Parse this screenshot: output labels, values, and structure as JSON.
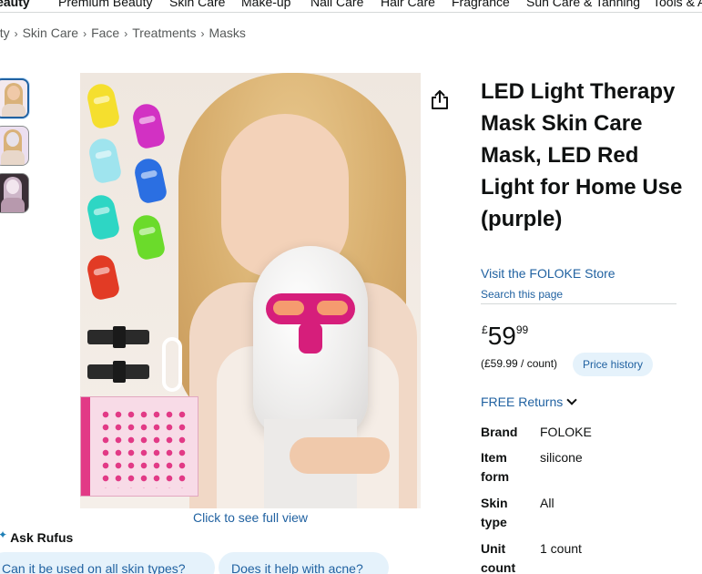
{
  "top_nav": {
    "items": [
      "Beauty",
      "Premium Beauty",
      "Skin Care",
      "Make-up",
      "Nail Care",
      "Hair Care",
      "Fragrance",
      "Sun Care & Tanning",
      "Tools & A"
    ]
  },
  "breadcrumb": {
    "items": [
      "Beauty",
      "Skin Care",
      "Face",
      "Treatments",
      "Masks"
    ]
  },
  "gallery": {
    "thumbnail_count": 3,
    "click_full_view": "Click to see full view",
    "share_icon": "share-icon"
  },
  "rufus": {
    "title": "Ask Rufus",
    "chips": [
      "Can it be used on all skin types?",
      "Does it help with acne?"
    ]
  },
  "product": {
    "title": "LED Light Therapy Mask Skin Care Mask, LED Red Light for Home Use (purple)",
    "store_link": "Visit the FOLOKE Store",
    "search_page": "Search this page",
    "price": {
      "symbol": "£",
      "whole": "59",
      "fraction": "99"
    },
    "unit_price": "(£59.99 / count)",
    "price_history": "Price history",
    "returns": "FREE Returns",
    "specs": [
      {
        "label": "Brand",
        "value": "FOLOKE"
      },
      {
        "label": "Item form",
        "value": "silicone"
      },
      {
        "label": "Skin type",
        "value": "All"
      },
      {
        "label": "Unit count",
        "value": "1 count"
      }
    ]
  },
  "colors": {
    "link": "#2162a1",
    "chip_bg": "#e5f2fb",
    "mask_accent": "#d61e7b"
  }
}
